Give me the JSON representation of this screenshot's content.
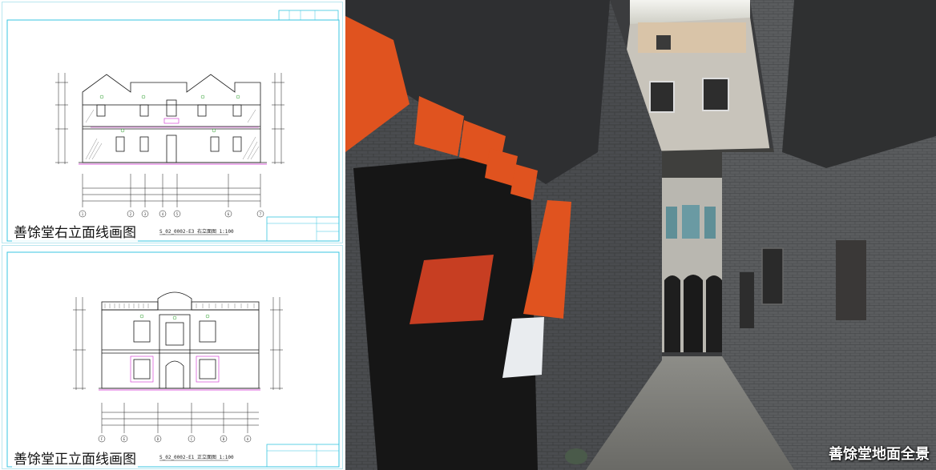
{
  "panels": {
    "right_elevation": {
      "caption": "善馀堂右立面线画图",
      "sheet_label": "S_02_0002-E3  右立面图  1:100",
      "axis_labels": [
        "1",
        "2",
        "3",
        "4",
        "5",
        "6",
        "7"
      ]
    },
    "front_elevation": {
      "caption": "善馀堂正立面线画图",
      "sheet_label": "S_02_0002-E1  正立面图  1:100",
      "axis_labels": [
        "F",
        "E",
        "D",
        "C",
        "B",
        "A"
      ]
    },
    "photo": {
      "caption": "善馀堂地面全景"
    }
  },
  "colors": {
    "cad_border": "#39c6e0",
    "cad_line": "#1a1a1a",
    "cad_accent": "#d02ad0",
    "cad_green": "#2a9d2a",
    "banner_red": "#e0531f"
  }
}
